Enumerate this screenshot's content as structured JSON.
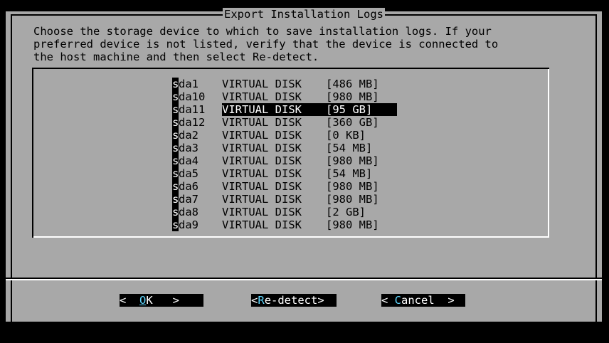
{
  "dialog": {
    "title": "Export Installation Logs",
    "description": "Choose the storage device to which to save installation logs. If your\npreferred device is not listed, verify that the device is connected to\nthe host machine and then select Re-detect."
  },
  "devices": [
    {
      "name_first": "s",
      "name_rest": "da1",
      "model": "VIRTUAL DISK",
      "size": "[486 MB]",
      "selected": false
    },
    {
      "name_first": "s",
      "name_rest": "da10",
      "model": "VIRTUAL DISK",
      "size": "[980 MB]",
      "selected": false
    },
    {
      "name_first": "s",
      "name_rest": "da11",
      "model": "VIRTUAL DISK",
      "size": "[95 GB]",
      "selected": true
    },
    {
      "name_first": "s",
      "name_rest": "da12",
      "model": "VIRTUAL DISK",
      "size": "[360 GB]",
      "selected": false
    },
    {
      "name_first": "s",
      "name_rest": "da2",
      "model": "VIRTUAL DISK",
      "size": "[0 KB]",
      "selected": false
    },
    {
      "name_first": "s",
      "name_rest": "da3",
      "model": "VIRTUAL DISK",
      "size": "[54 MB]",
      "selected": false
    },
    {
      "name_first": "s",
      "name_rest": "da4",
      "model": "VIRTUAL DISK",
      "size": "[980 MB]",
      "selected": false
    },
    {
      "name_first": "s",
      "name_rest": "da5",
      "model": "VIRTUAL DISK",
      "size": "[54 MB]",
      "selected": false
    },
    {
      "name_first": "s",
      "name_rest": "da6",
      "model": "VIRTUAL DISK",
      "size": "[980 MB]",
      "selected": false
    },
    {
      "name_first": "s",
      "name_rest": "da7",
      "model": "VIRTUAL DISK",
      "size": "[980 MB]",
      "selected": false
    },
    {
      "name_first": "s",
      "name_rest": "da8",
      "model": "VIRTUAL DISK",
      "size": "[2 GB]",
      "selected": false
    },
    {
      "name_first": "s",
      "name_rest": "da9",
      "model": "VIRTUAL DISK",
      "size": "[980 MB]",
      "selected": false
    }
  ],
  "buttons": {
    "ok": {
      "left": "<  ",
      "hot": "O",
      "rest": "K",
      "right": "   >"
    },
    "redetect": {
      "left": "<",
      "hot": "R",
      "rest": "e-detect",
      "right": ">"
    },
    "cancel": {
      "left": "< ",
      "hot": "C",
      "rest": "ancel",
      "right": "  >"
    }
  },
  "colors": {
    "dialog_background": "#a8a8a8",
    "screen_background": "#000000",
    "hotkey": "#5fd7ff"
  }
}
